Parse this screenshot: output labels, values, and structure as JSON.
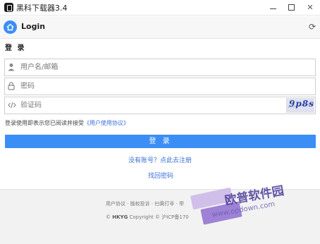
{
  "window": {
    "title": "黑科下载器3.4",
    "minimize_glyph": "",
    "maximize_glyph": "",
    "close_glyph": "✕"
  },
  "header": {
    "title": "Login",
    "refresh_glyph": "⟳"
  },
  "form": {
    "section_title": "登 录",
    "username": {
      "placeholder": "用户名/邮箱",
      "value": ""
    },
    "password": {
      "placeholder": "密码",
      "value": ""
    },
    "captcha": {
      "placeholder": "验证码",
      "value": "",
      "image_text": "9p8s"
    },
    "agreement_text": "登录使用即表示您已阅读并接受",
    "agreement_link": "《用户使用协议》",
    "login_button": "登 录",
    "register_link": "没有账号？点此去注册",
    "forgot_link": "找回密码"
  },
  "footer": {
    "links": "用户协议 · 版权投诉 · 扫黄打非 · 举",
    "brand": "HKYG",
    "copyright": "Copyright © 沪ICP备170"
  },
  "watermark": {
    "text": "欧普软件园",
    "url": "www.opdown.com"
  },
  "colors": {
    "accent": "#3b8ef5",
    "link": "#3a6fd8",
    "footer_bg": "#f2f2f2"
  },
  "icons": {
    "home": "home-icon",
    "refresh": "refresh-icon",
    "user": "user-icon",
    "lock": "lock-icon",
    "code": "code-icon"
  }
}
